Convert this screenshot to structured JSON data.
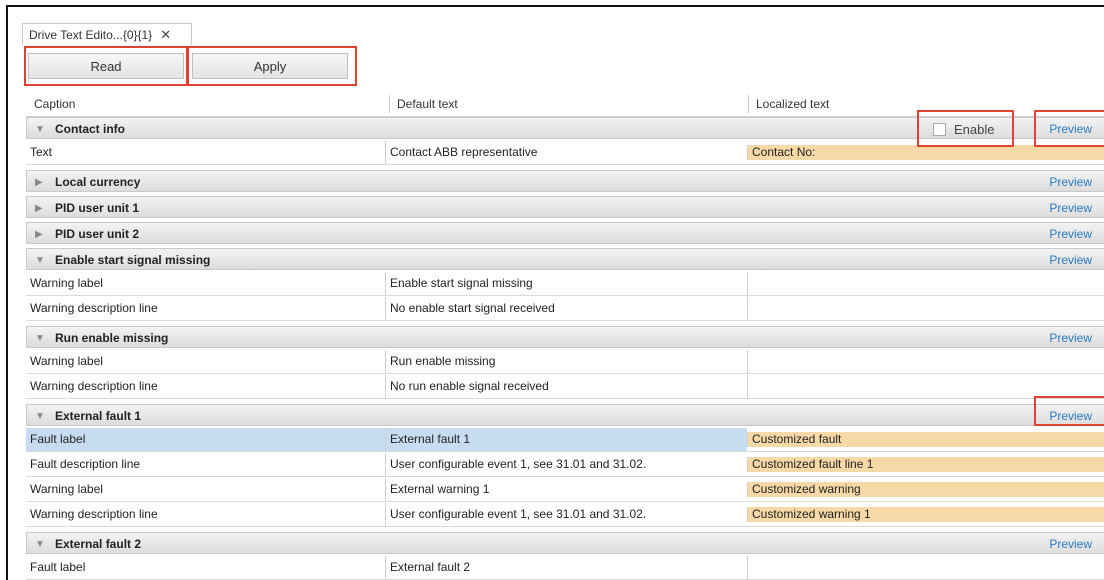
{
  "tab": {
    "title": "Drive Text Edito...{0}{1}",
    "close": "✕"
  },
  "toolbar": {
    "read_label": "Read",
    "apply_label": "Apply"
  },
  "columns": {
    "caption": "Caption",
    "default": "Default text",
    "localized": "Localized text"
  },
  "enable_label": "Enable",
  "preview_label": "Preview",
  "colors": {
    "highlight": "#e2412f",
    "localized_bg": "#f6d9a6",
    "selected_bg": "#c7dcf1",
    "link": "#2a7ac0"
  },
  "groups": [
    {
      "title": "Contact info",
      "expanded": true,
      "rows": [
        {
          "caption": "Text",
          "default": "Contact ABB representative",
          "localized": "Contact No:"
        }
      ]
    },
    {
      "title": "Local currency",
      "expanded": false,
      "rows": []
    },
    {
      "title": "PID user unit 1",
      "expanded": false,
      "rows": []
    },
    {
      "title": "PID user unit 2",
      "expanded": false,
      "rows": []
    },
    {
      "title": "Enable start signal missing",
      "expanded": true,
      "rows": [
        {
          "caption": "Warning label",
          "default": "Enable start signal missing",
          "localized": ""
        },
        {
          "caption": "Warning description line",
          "default": "No enable start signal received",
          "localized": ""
        }
      ]
    },
    {
      "title": "Run enable missing",
      "expanded": true,
      "rows": [
        {
          "caption": "Warning label",
          "default": "Run enable missing",
          "localized": ""
        },
        {
          "caption": "Warning description line",
          "default": "No run enable signal received",
          "localized": ""
        }
      ]
    },
    {
      "title": "External fault 1",
      "expanded": true,
      "rows": [
        {
          "caption": "Fault label",
          "default": "External fault 1",
          "localized": "Customized fault",
          "selected": true
        },
        {
          "caption": "Fault description line",
          "default": "User configurable event 1, see 31.01 and 31.02.",
          "localized": "Customized fault line 1"
        },
        {
          "caption": "Warning label",
          "default": "External warning 1",
          "localized": "Customized warning"
        },
        {
          "caption": "Warning description line",
          "default": "User configurable event 1, see 31.01 and 31.02.",
          "localized": "Customized warning 1"
        }
      ]
    },
    {
      "title": "External fault 2",
      "expanded": true,
      "rows": [
        {
          "caption": "Fault label",
          "default": "External fault 2",
          "localized": ""
        }
      ]
    }
  ]
}
